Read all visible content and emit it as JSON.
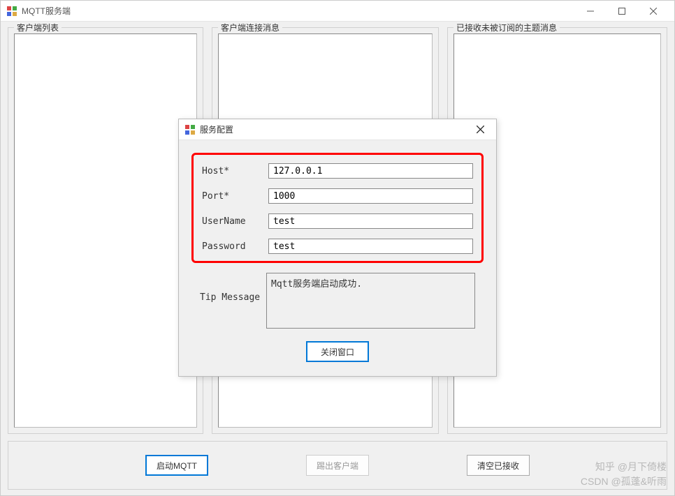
{
  "mainWindow": {
    "title": "MQTT服务端",
    "panel1Label": "客户端列表",
    "panel2Label": "客户端连接消息",
    "panel3Label": "已接收未被订阅的主题消息",
    "startBtn": "启动MQTT",
    "kickBtn": "踢出客户端",
    "clearBtn": "清空已接收"
  },
  "dialog": {
    "title": "服务配置",
    "hostLabel": "Host*",
    "hostValue": "127.0.0.1",
    "portLabel": "Port*",
    "portValue": "1000",
    "userLabel": "UserName",
    "userValue": "test",
    "pwdLabel": "Password",
    "pwdValue": "test",
    "tipLabel": "Tip Message",
    "tipValue": "Mqtt服务端启动成功.",
    "closeBtn": "关闭窗口"
  },
  "watermark": {
    "line1": "知乎 @月下倚楼",
    "line2": "CSDN @孤蓬&听雨"
  }
}
